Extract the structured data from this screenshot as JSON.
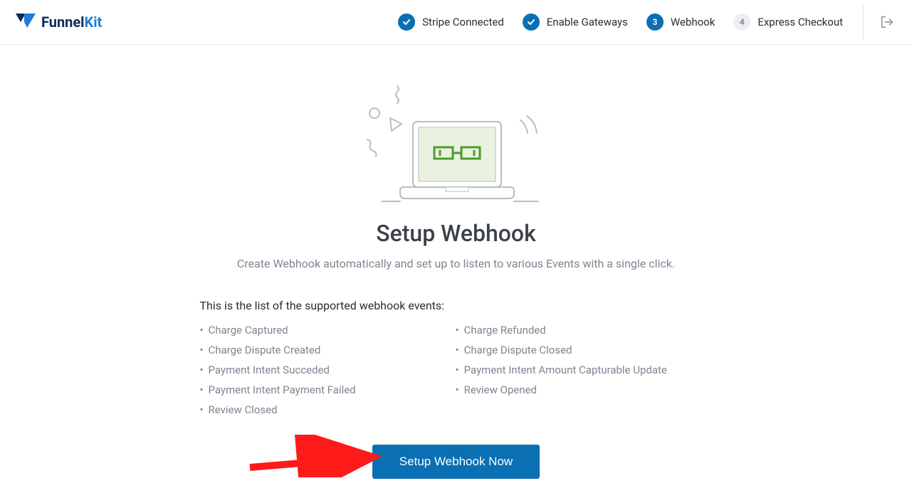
{
  "brand": {
    "part1": "Funnel",
    "part2": "Kit"
  },
  "steps": [
    {
      "label": "Stripe Connected",
      "state": "done"
    },
    {
      "label": "Enable Gateways",
      "state": "done"
    },
    {
      "label": "Webhook",
      "state": "active",
      "num": "3"
    },
    {
      "label": "Express Checkout",
      "state": "pending",
      "num": "4"
    }
  ],
  "page": {
    "title": "Setup Webhook",
    "subtitle": "Create Webhook automatically and set up to listen to various Events with a single click.",
    "events_intro": "This is the list of the supported webhook events:",
    "events_left": [
      "Charge Captured",
      "Charge Dispute Created",
      "Payment Intent Succeded",
      "Payment Intent Payment Failed",
      "Review Closed"
    ],
    "events_right": [
      "Charge Refunded",
      "Charge Dispute Closed",
      "Payment Intent Amount Capturable Update",
      "Review Opened"
    ],
    "cta": "Setup Webhook Now"
  }
}
